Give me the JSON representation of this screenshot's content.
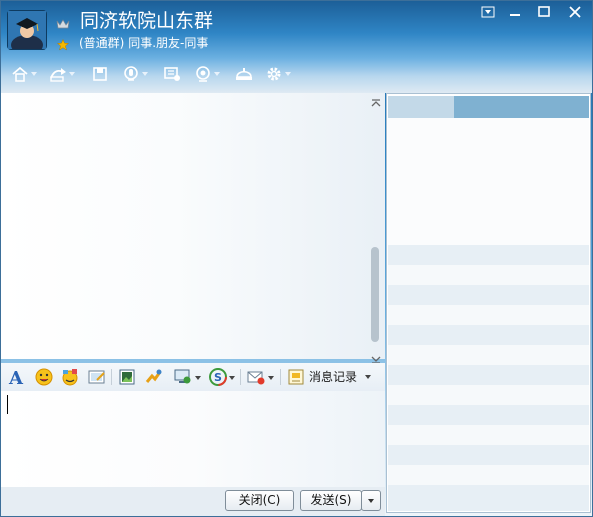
{
  "window": {
    "title": "同济软院山东群",
    "group_type": "(普通群)",
    "category": "同事.朋友-同事",
    "controls": [
      "menu",
      "minimize",
      "maximize",
      "close"
    ]
  },
  "toolbar": {
    "icons": [
      "home-icon",
      "share-icon",
      "file-icon",
      "voice-icon",
      "message-icon",
      "video-icon",
      "sign-icon",
      "settings-icon"
    ]
  },
  "format_toolbar": {
    "icons": [
      "font-icon",
      "smiley-icon",
      "magic-face-icon",
      "screenshot-icon",
      "image-icon",
      "shake-icon",
      "screen-share-icon",
      "soso-icon",
      "mail-icon",
      "history-icon"
    ],
    "history_label": "消息记录"
  },
  "actions": {
    "close_label": "关闭(C)",
    "send_label": "发送(S)"
  },
  "colors": {
    "title_bar": "#2f85c5",
    "accent": "#7fb1d1",
    "panel_stripe": "#e6eef5"
  }
}
